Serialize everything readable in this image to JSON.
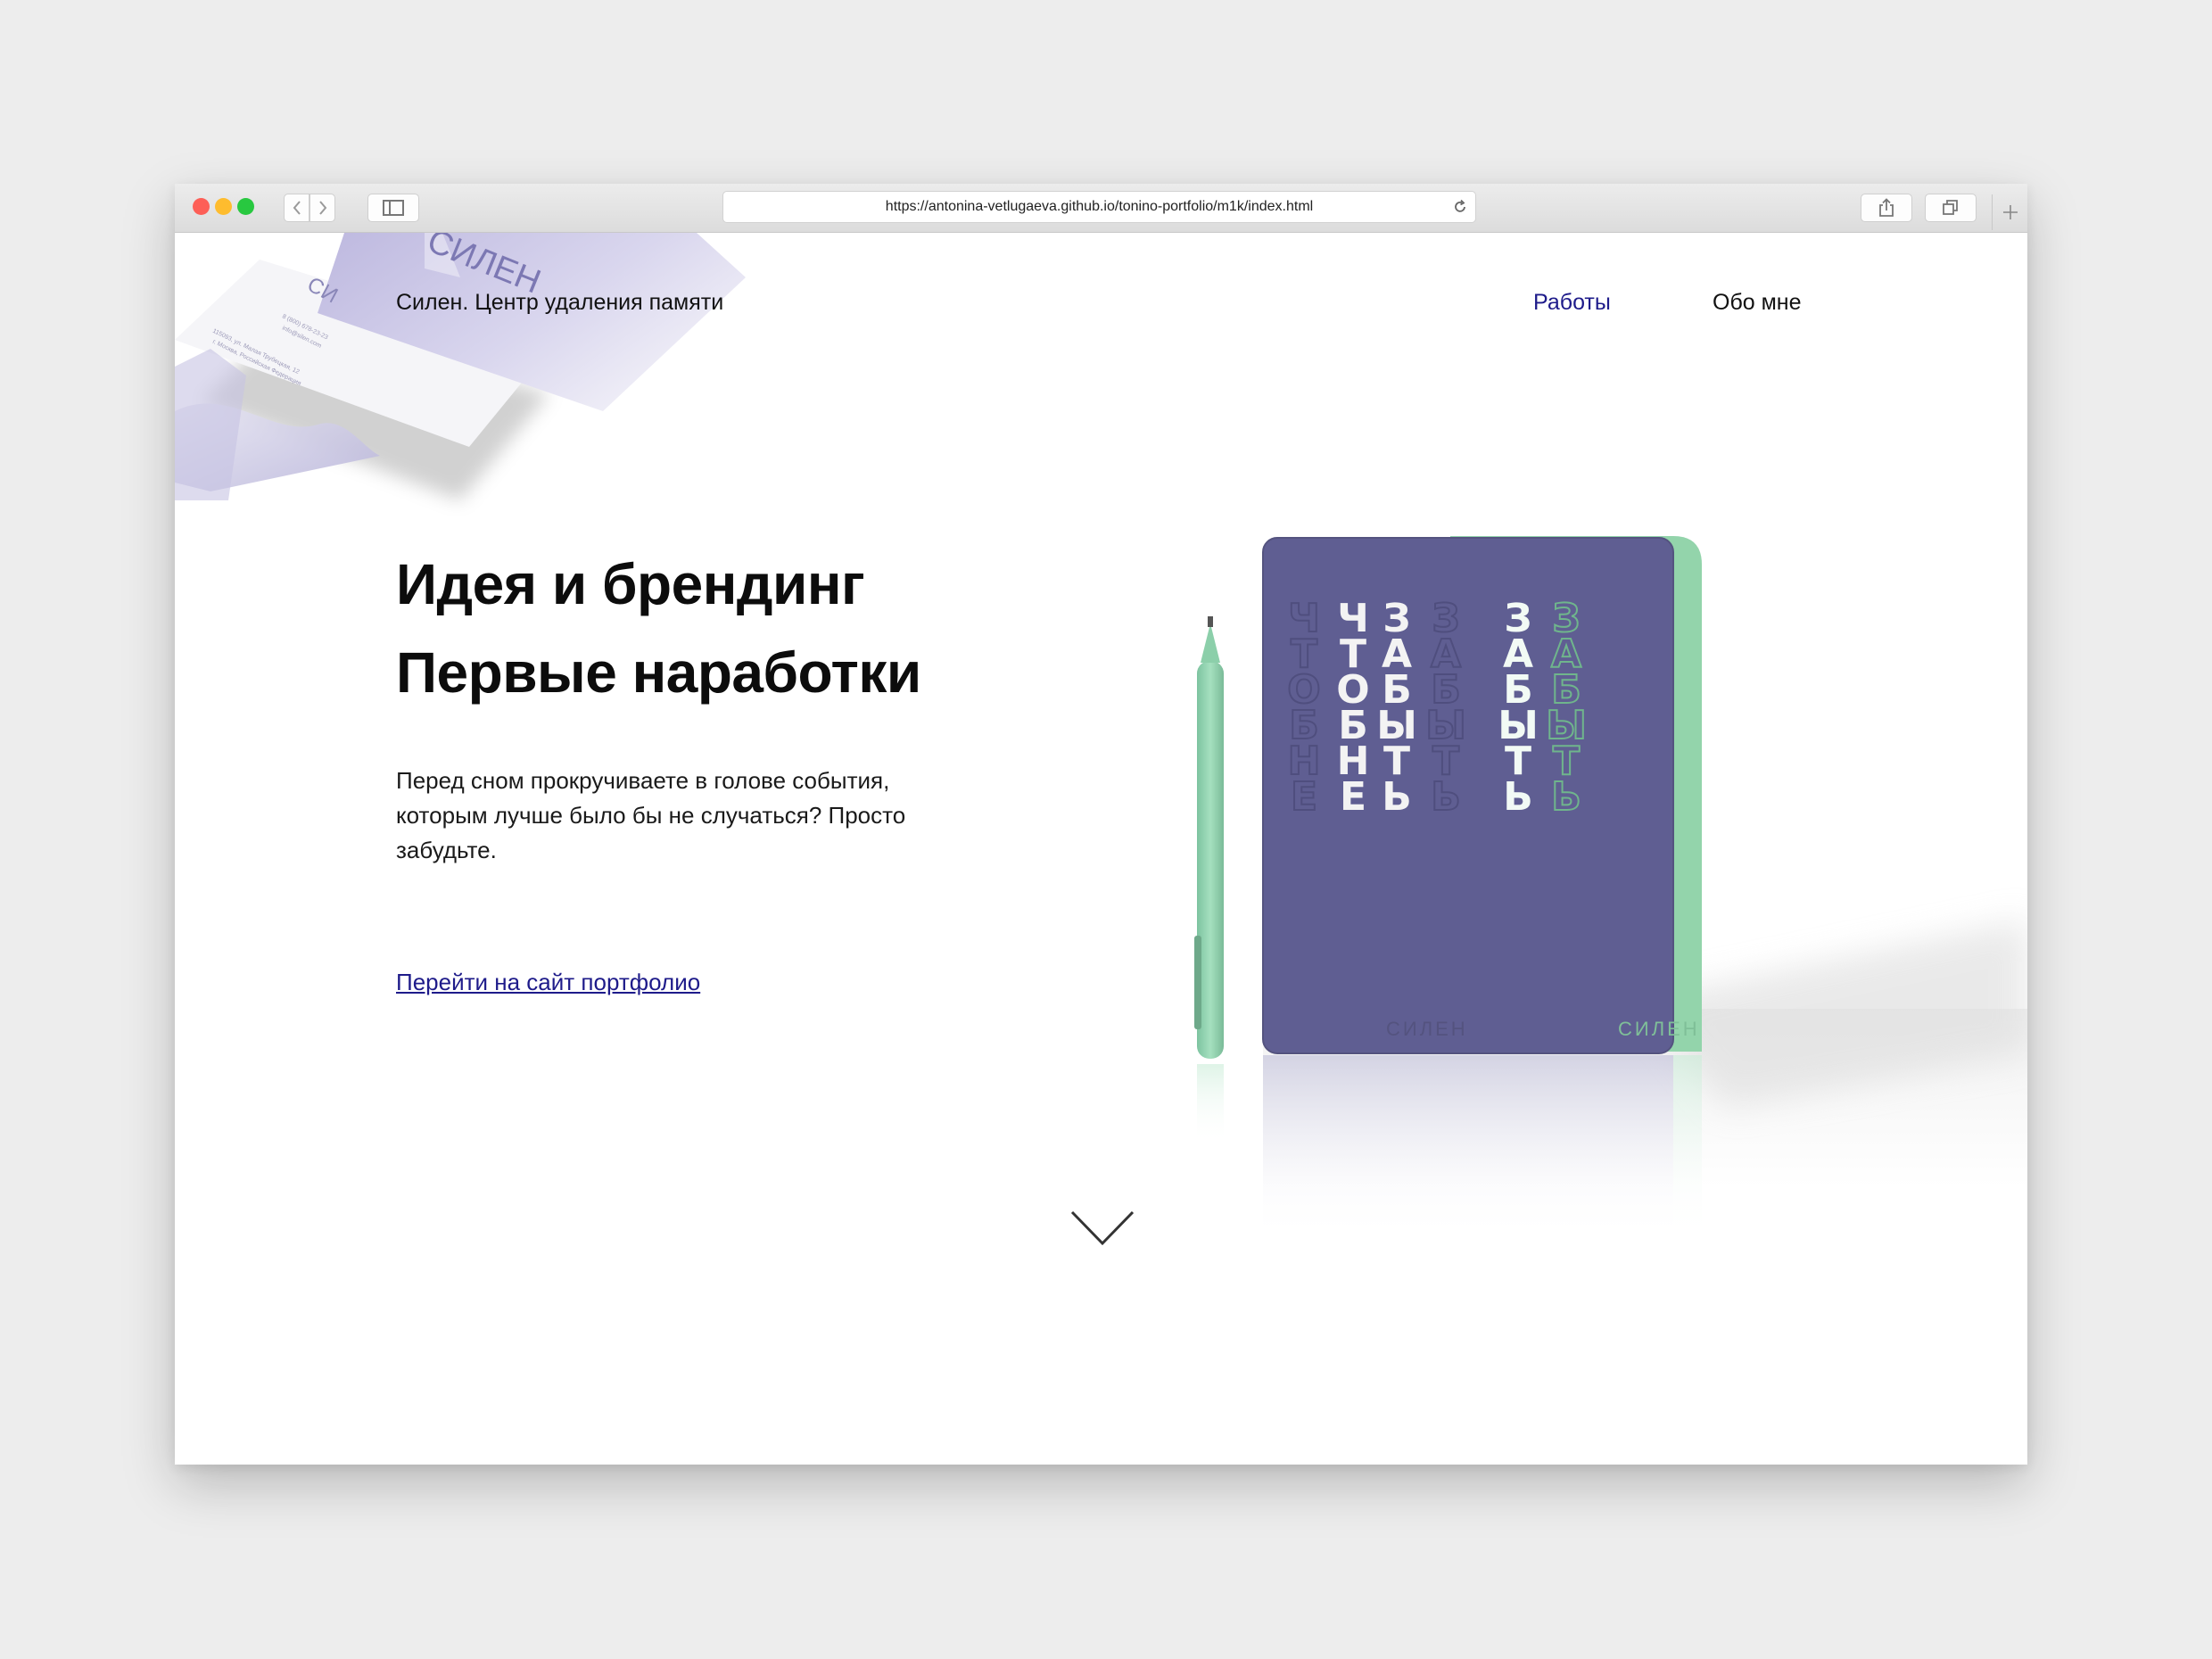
{
  "browser": {
    "url": "https://antonina-vetlugaeva.github.io/tonino-portfolio/m1k/index.html"
  },
  "header": {
    "site_title": "Силен. Центр удаления памяти",
    "nav": [
      "Работы",
      "Обо мне"
    ]
  },
  "hero": {
    "headline_line1": "Идея и брендинг",
    "headline_line2": "Первые наработки",
    "description": "Перед сном прокручиваете в голове события, которым лучше было бы не случаться? Просто забудьте.",
    "link": "Перейти на сайт портфолио"
  },
  "artwork": {
    "brand": "СИЛЕН",
    "purple_cover": {
      "col1": [
        "Ч",
        "Т",
        "О",
        "Б",
        "Н",
        "Е"
      ],
      "col2": [
        "Ч",
        "Т",
        "О",
        "Б",
        "Н",
        "Е"
      ],
      "col3": [
        "З",
        "А",
        "Б",
        "Ы",
        "Т",
        "Ь"
      ],
      "col4": [
        "З",
        "А",
        "Б",
        "Ы",
        "Т",
        "Ь"
      ]
    },
    "green_cover": {
      "col1": [
        "З",
        "А",
        "Б",
        "Ы",
        "Т",
        "Ь"
      ],
      "col2": [
        "З",
        "А",
        "Б",
        "Ы",
        "Т",
        "Ь"
      ]
    },
    "colors": {
      "purple": "#5f5e92",
      "green": "#93d4ab",
      "link_blue": "#1e1b8a"
    }
  },
  "card_text": {
    "logo": "СИЛЕН",
    "phone": "8 (800) 678-23-23",
    "email": "info@silen.com",
    "address_line1": "115093, ул. Малая Трубецкая, 12",
    "address_line2": "г. Москва, Российская Федерация"
  },
  "icons": [
    "back-icon",
    "forward-icon",
    "sidebar-icon",
    "reload-icon",
    "share-icon",
    "tabs-icon",
    "new-tab-icon",
    "chevron-down-icon"
  ]
}
